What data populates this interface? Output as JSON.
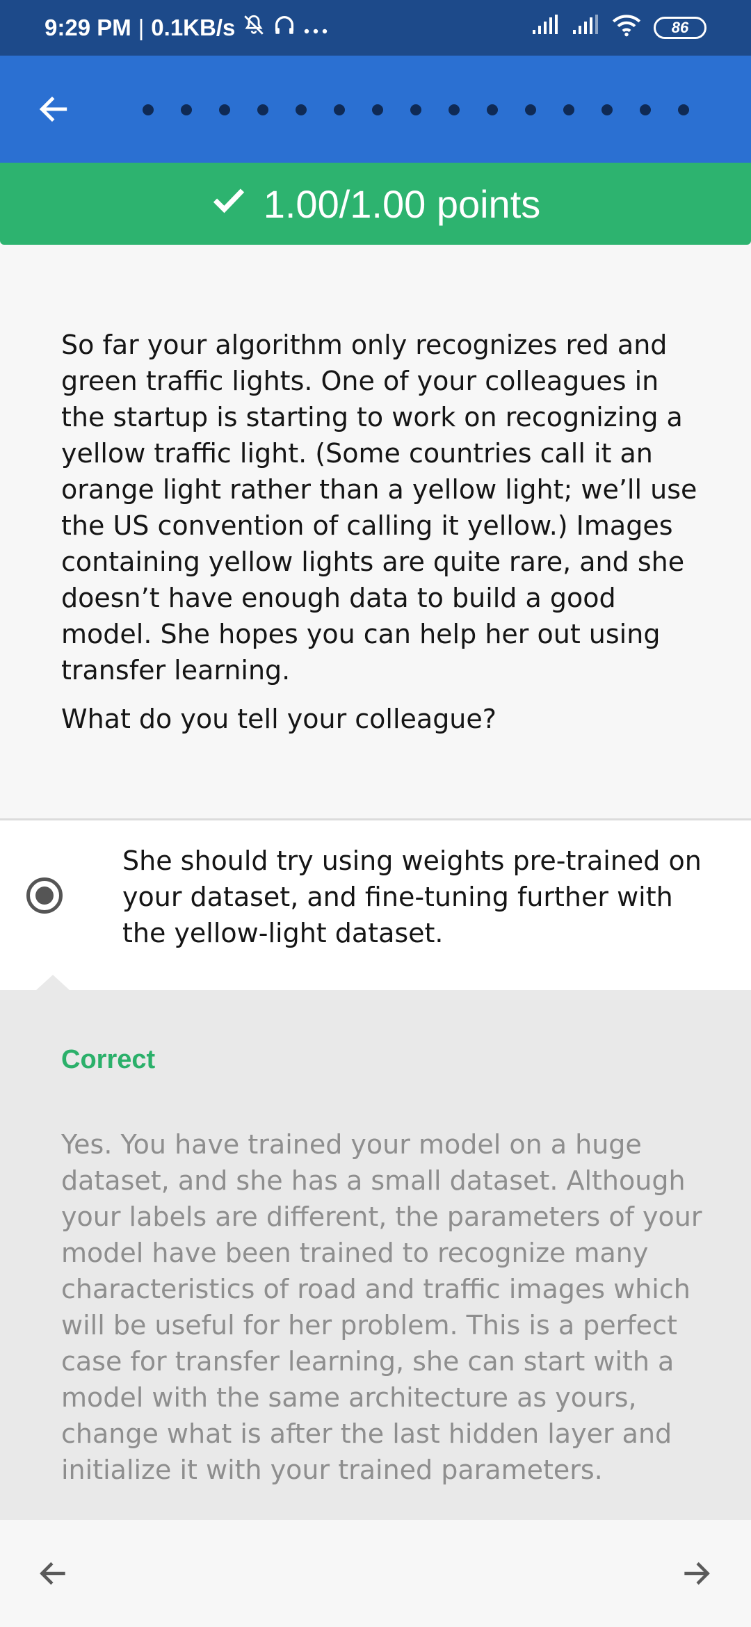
{
  "status_bar": {
    "time": "9:29 PM",
    "separator": "|",
    "net_speed": "0.1KB/s",
    "battery": "86",
    "icons": [
      "mute-icon",
      "headset-icon",
      "more-icon",
      "signal-icon",
      "signal-icon",
      "wifi-icon",
      "battery-icon"
    ]
  },
  "app_bar": {
    "progress_dots": 15,
    "back_icon": "arrow-left-icon"
  },
  "score": {
    "text": "1.00/1.00 points",
    "icon": "check-icon",
    "color": "#2db36f"
  },
  "question": {
    "body": "So far your algorithm only recognizes red and green traffic lights. One of your colleagues in the startup is starting to work on recognizing a yellow traffic light. (Some countries call it an orange light rather than a yellow light; we’ll use the US convention of calling it yellow.) Images containing yellow lights are quite rare, and she doesn’t have enough data to build a good model. She hopes you can help her out using transfer learning.",
    "prompt": "What do you tell your colleague?"
  },
  "answer": {
    "text": "She should try using weights pre-trained on your dataset, and fine-tuning further with the yellow-light dataset.",
    "selected": true
  },
  "feedback": {
    "title": "Correct",
    "title_color": "#2bb06a",
    "text": "Yes. You have trained your model on a huge dataset, and she has a small dataset. Although your labels are different, the parameters of your model have been trained to recognize many characteristics of road and traffic images which will be useful for her problem. This is a perfect case for transfer learning, she can start with a model with the same architecture as yours, change what is after the last hidden layer and initialize it with your trained parameters."
  },
  "bottom_nav": {
    "prev_icon": "arrow-left-icon",
    "next_icon": "arrow-right-icon"
  }
}
